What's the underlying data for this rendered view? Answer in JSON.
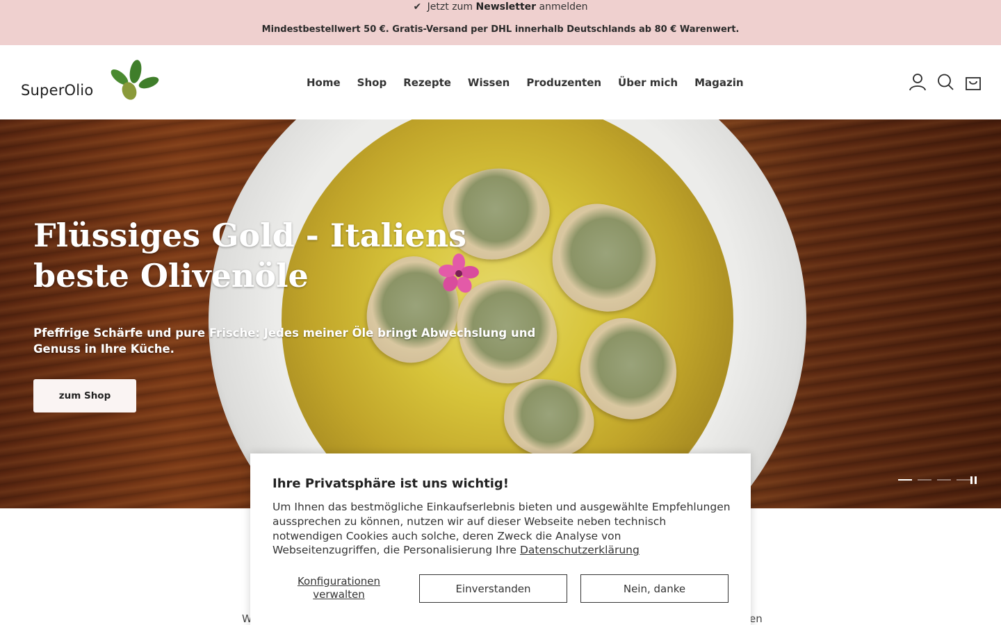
{
  "announcement": {
    "line1_prefix": "Jetzt zum",
    "line1_link": "Newsletter",
    "line1_suffix": "anmelden",
    "line2": "Mindestbestellwert 50 €. Gratis-Versand per DHL innerhalb Deutschlands ab 80 € Warenwert."
  },
  "header": {
    "logo_text": "SuperOlio",
    "nav": [
      "Home",
      "Shop",
      "Rezepte",
      "Wissen",
      "Produzenten",
      "Über mich",
      "Magazin"
    ],
    "icons": [
      "account-icon",
      "search-icon",
      "cart-icon"
    ]
  },
  "hero": {
    "title": "Flüssiges Gold - Italiens beste Olivenöle",
    "subtitle": "Pfeffrige Schärfe und pure Frische: Jedes meiner Öle bringt Abwechslung und Genuss in Ihre Küche.",
    "button_label": "zum Shop",
    "slides_total": 4,
    "active_slide": 1
  },
  "below": {
    "left_fragment": "W",
    "right_fragment": "en"
  },
  "cookie": {
    "title": "Ihre Privatsphäre ist uns wichtig!",
    "text": "Um Ihnen das bestmögliche Einkaufserlebnis bieten und ausgewählte Empfehlungen aussprechen zu können, nutzen wir auf dieser Webseite neben technisch notwendigen Cookies auch solche, deren Zweck die Analyse von Webseitenzugriffen, die Personalisierung Ihre",
    "link": "Datenschutzerklärung",
    "configure_label": "Konfigurationen verwalten",
    "accept_label": "Einverstanden",
    "decline_label": "Nein, danke"
  },
  "colors": {
    "announcement_bg": "#efd0cf",
    "button_bg": "#faf4f3"
  }
}
